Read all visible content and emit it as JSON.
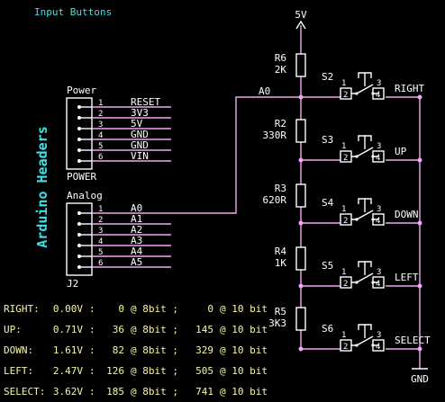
{
  "title": "Input Buttons",
  "header_label": "Arduino Headers",
  "power_header": {
    "label": "Power",
    "ref": "POWER",
    "pins": [
      {
        "num": "1",
        "signal": "RESET"
      },
      {
        "num": "2",
        "signal": "3V3"
      },
      {
        "num": "3",
        "signal": "5V"
      },
      {
        "num": "4",
        "signal": "GND"
      },
      {
        "num": "5",
        "signal": "GND"
      },
      {
        "num": "6",
        "signal": "VIN"
      }
    ]
  },
  "analog_header": {
    "label": "Analog",
    "ref": "J2",
    "pins": [
      {
        "num": "1",
        "signal": "A0"
      },
      {
        "num": "2",
        "signal": "A1"
      },
      {
        "num": "3",
        "signal": "A2"
      },
      {
        "num": "4",
        "signal": "A3"
      },
      {
        "num": "5",
        "signal": "A4"
      },
      {
        "num": "6",
        "signal": "A5"
      }
    ]
  },
  "net_a0": "A0",
  "supply": "5V",
  "ground": "GND",
  "resistors": [
    {
      "ref": "R6",
      "value": "2K"
    },
    {
      "ref": "R2",
      "value": "330R"
    },
    {
      "ref": "R3",
      "value": "620R"
    },
    {
      "ref": "R4",
      "value": "1K"
    },
    {
      "ref": "R5",
      "value": "3K3"
    }
  ],
  "switches": [
    {
      "ref": "S2",
      "label": "RIGHT"
    },
    {
      "ref": "S3",
      "label": "UP"
    },
    {
      "ref": "S4",
      "label": "DOWN"
    },
    {
      "ref": "S5",
      "label": "LEFT"
    },
    {
      "ref": "S6",
      "label": "SELECT"
    }
  ],
  "switch_pins": [
    "1",
    "2",
    "3",
    "4"
  ],
  "readings": [
    {
      "name": "RIGHT:",
      "volts": "0.00V",
      "bit8": "0",
      "bit10": "0"
    },
    {
      "name": "UP:",
      "volts": "0.71V",
      "bit8": "36",
      "bit10": "145"
    },
    {
      "name": "DOWN:",
      "volts": "1.61V",
      "bit8": "82",
      "bit10": "329"
    },
    {
      "name": "LEFT:",
      "volts": "2.47V",
      "bit8": "126",
      "bit10": "505"
    },
    {
      "name": "SELECT:",
      "volts": "3.62V",
      "bit8": "185",
      "bit10": "741"
    }
  ],
  "reading_units": {
    "sep": ":",
    "at8": "@ 8bit ;",
    "at10": "@ 10 bit"
  },
  "colors": {
    "background": "#000000",
    "wire": "#f4a6f4",
    "text": "#ffffff",
    "heading": "#40e0e8",
    "readings": "#f8f6a0"
  }
}
